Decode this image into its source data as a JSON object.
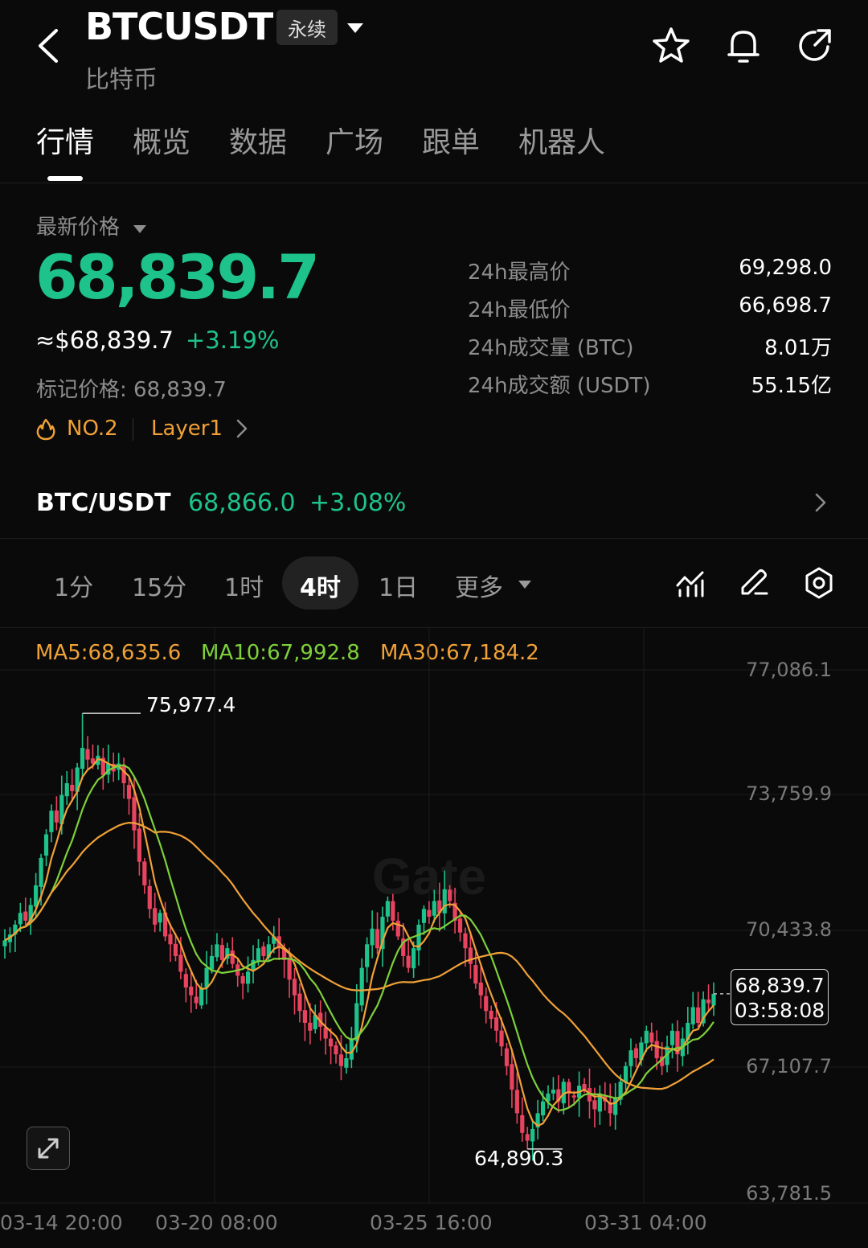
{
  "header": {
    "title": "BTCUSDT",
    "badge": "永续",
    "subtitle": "比特币"
  },
  "tabs": [
    {
      "label": "行情",
      "active": true
    },
    {
      "label": "概览"
    },
    {
      "label": "数据"
    },
    {
      "label": "广场"
    },
    {
      "label": "跟单"
    },
    {
      "label": "机器人"
    }
  ],
  "ticker": {
    "price_label": "最新价格",
    "last_price": "68,839.7",
    "usd_price": "≈$68,839.7",
    "change_pct": "+3.19%",
    "mark_price": "标记价格: 68,839.7",
    "rank": "NO.2",
    "category": "Layer1"
  },
  "stats": [
    {
      "label": "24h最高价",
      "value": "69,298.0"
    },
    {
      "label": "24h最低价",
      "value": "66,698.7"
    },
    {
      "label": "24h成交量 (BTC)",
      "value": "8.01万"
    },
    {
      "label": "24h成交额 (USDT)",
      "value": "55.15亿"
    }
  ],
  "spot": {
    "pair": "BTC/USDT",
    "price": "68,866.0",
    "change": "+3.08%"
  },
  "intervals": {
    "items": [
      "1分",
      "15分",
      "1时",
      "4时",
      "1日"
    ],
    "active": "4时",
    "more": "更多"
  },
  "indicators": {
    "ma5": "MA5:68,635.6",
    "ma10": "MA10:67,992.8",
    "ma30": "MA30:67,184.2"
  },
  "chart_data": {
    "type": "candlestick",
    "watermark": "Gate",
    "y_ticks": [
      "77,086.1",
      "73,759.9",
      "70,433.8",
      "67,107.7",
      "63,781.5"
    ],
    "x_ticks": [
      "03-14 20:00",
      "03-20 08:00",
      "03-25 16:00",
      "03-31 04:00"
    ],
    "ylim": [
      63781.5,
      77086.1
    ],
    "high_marker": "75,977.4",
    "low_marker": "64,890.3",
    "current_price": "68,839.7",
    "countdown": "03:58:08",
    "colors": {
      "up": "#1ec28b",
      "down": "#e8435f",
      "ma5": "#f0a137",
      "ma10": "#7ed13a",
      "ma30": "#f0a137"
    },
    "closes": [
      70200,
      70350,
      70600,
      70900,
      70700,
      71100,
      71600,
      72300,
      72900,
      73500,
      73200,
      73900,
      74200,
      74000,
      74600,
      75100,
      74800,
      74700,
      74900,
      74400,
      74700,
      74500,
      74700,
      74200,
      73800,
      73000,
      72200,
      71600,
      71000,
      70600,
      70900,
      70300,
      70100,
      69800,
      69400,
      69000,
      68800,
      68600,
      69000,
      69500,
      69800,
      70100,
      69700,
      70000,
      69600,
      69300,
      69100,
      69400,
      69700,
      70000,
      69800,
      70100,
      70300,
      70000,
      69700,
      69200,
      68800,
      68400,
      68100,
      67900,
      68300,
      68000,
      67700,
      67500,
      67300,
      67000,
      67200,
      67700,
      68600,
      69500,
      70100,
      70500,
      70000,
      70800,
      71200,
      70700,
      70300,
      69800,
      69500,
      70000,
      70600,
      71000,
      70800,
      71200,
      70900,
      71500,
      71200,
      70700,
      70400,
      70000,
      69600,
      69100,
      68800,
      68400,
      68200,
      67900,
      67500,
      67000,
      66400,
      65800,
      65300,
      65100,
      65400,
      65800,
      66100,
      66300,
      66400,
      66100,
      66600,
      66300,
      66200,
      66500,
      66400,
      66100,
      65900,
      66300,
      66100,
      65800,
      66200,
      66600,
      67000,
      67400,
      67200,
      67600,
      67900,
      67600,
      67200,
      67000,
      67500,
      67900,
      67300,
      67700,
      68100,
      68500,
      68100,
      68700,
      68600,
      68839.7
    ]
  }
}
